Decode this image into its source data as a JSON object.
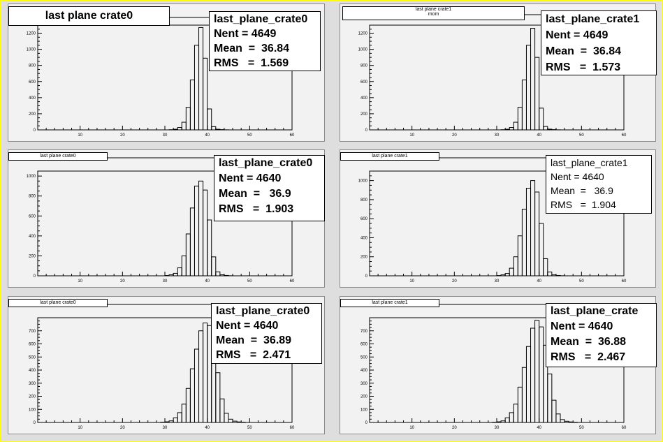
{
  "colors": {
    "frame": "#ffff00",
    "canvas": "#dedede",
    "pad": "#f2f2f2",
    "line": "#000000",
    "box": "#ffffff"
  },
  "chart_data": [
    {
      "type": "bar",
      "title": "last plane crate0",
      "subtitle": "",
      "stats": {
        "name": "last_plane_crate0",
        "entries_label": "Nent = 4649",
        "mean_label": "Mean  =  36.84",
        "rms_label": "RMS   =  1.569"
      },
      "xlim": [
        0,
        60
      ],
      "ylim": [
        0,
        1300
      ],
      "xticks": [
        10,
        20,
        30,
        40,
        50,
        60
      ],
      "xtick_labels": [
        "10",
        "20",
        "30",
        "40",
        "50",
        "60"
      ],
      "yticks": [
        0,
        200,
        400,
        600,
        800,
        1000,
        1200
      ],
      "ytick_labels": [
        "0",
        "200",
        "400",
        "600",
        "800",
        "1000",
        "1200"
      ],
      "bin_width": 1,
      "bins_start": 31,
      "values": [
        2,
        8,
        30,
        95,
        280,
        620,
        1050,
        1270,
        890,
        260,
        40,
        8,
        3,
        1
      ]
    },
    {
      "type": "bar",
      "title": "last plane crate1",
      "subtitle": "mom",
      "stats": {
        "name": "last_plane_crate1",
        "entries_label": "Nent = 4649",
        "mean_label": "Mean  =  36.84",
        "rms_label": "RMS   =  1.573"
      },
      "xlim": [
        0,
        60
      ],
      "ylim": [
        0,
        1300
      ],
      "xticks": [
        10,
        20,
        30,
        40,
        50,
        60
      ],
      "xtick_labels": [
        "10",
        "20",
        "30",
        "40",
        "50",
        "60"
      ],
      "yticks": [
        0,
        200,
        400,
        600,
        800,
        1000,
        1200
      ],
      "ytick_labels": [
        "0",
        "200",
        "400",
        "600",
        "800",
        "1000",
        "1200"
      ],
      "bin_width": 1,
      "bins_start": 31,
      "values": [
        2,
        8,
        30,
        95,
        280,
        620,
        1050,
        1260,
        900,
        270,
        42,
        9,
        3,
        1
      ]
    },
    {
      "type": "bar",
      "title": "last plane crate0",
      "subtitle": "",
      "stats": {
        "name": "last_plane_crate0",
        "entries_label": "Nent = 4640",
        "mean_label": "Mean  =   36.9",
        "rms_label": "RMS   =  1.903"
      },
      "xlim": [
        0,
        60
      ],
      "ylim": [
        0,
        1050
      ],
      "xticks": [
        10,
        20,
        30,
        40,
        50,
        60
      ],
      "xtick_labels": [
        "10",
        "20",
        "30",
        "40",
        "50",
        "60"
      ],
      "yticks": [
        0,
        200,
        400,
        600,
        800,
        1000
      ],
      "ytick_labels": [
        "0",
        "200",
        "400",
        "600",
        "800",
        "1000"
      ],
      "bin_width": 1,
      "bins_start": 30,
      "values": [
        3,
        10,
        25,
        80,
        200,
        420,
        680,
        900,
        950,
        860,
        560,
        190,
        40,
        10,
        4,
        1
      ]
    },
    {
      "type": "bar",
      "title": "last plane crate1",
      "subtitle": "",
      "stats": {
        "name": "last_plane_crate1",
        "entries_label": "Nent = 4640",
        "mean_label": "Mean  =   36.9",
        "rms_label": "RMS   =  1.904"
      },
      "xlim": [
        0,
        60
      ],
      "ylim": [
        0,
        1100
      ],
      "xticks": [
        10,
        20,
        30,
        40,
        50,
        60
      ],
      "xtick_labels": [
        "10",
        "20",
        "30",
        "40",
        "50",
        "60"
      ],
      "yticks": [
        0,
        200,
        400,
        600,
        800,
        1000
      ],
      "ytick_labels": [
        "0",
        "200",
        "400",
        "600",
        "800",
        "1000"
      ],
      "bin_width": 1,
      "bins_start": 30,
      "values": [
        3,
        10,
        25,
        80,
        200,
        420,
        700,
        920,
        1000,
        880,
        550,
        180,
        40,
        10,
        4,
        1
      ]
    },
    {
      "type": "bar",
      "title": "last plane crate0",
      "subtitle": "",
      "stats": {
        "name": "last_plane_crate0",
        "entries_label": "Nent = 4640",
        "mean_label": "Mean  =  36.89",
        "rms_label": "RMS   =  2.471"
      },
      "xlim": [
        0,
        60
      ],
      "ylim": [
        0,
        800
      ],
      "xticks": [
        10,
        20,
        30,
        40,
        50,
        60
      ],
      "xtick_labels": [
        "10",
        "20",
        "30",
        "40",
        "50",
        "60"
      ],
      "yticks": [
        0,
        100,
        200,
        300,
        400,
        500,
        600,
        700
      ],
      "ytick_labels": [
        "0",
        "100",
        "200",
        "300",
        "400",
        "500",
        "600",
        "700"
      ],
      "bin_width": 1,
      "bins_start": 29,
      "values": [
        2,
        5,
        12,
        35,
        75,
        140,
        260,
        410,
        560,
        700,
        760,
        740,
        600,
        380,
        180,
        70,
        25,
        10,
        4,
        2
      ]
    },
    {
      "type": "bar",
      "title": "last plane crate1",
      "subtitle": "",
      "stats": {
        "name": "last_plane_crate",
        "entries_label": "Nent = 4640",
        "mean_label": "Mean  =  36.88",
        "rms_label": "RMS   =  2.467"
      },
      "xlim": [
        0,
        60
      ],
      "ylim": [
        0,
        800
      ],
      "xticks": [
        10,
        20,
        30,
        40,
        50,
        60
      ],
      "xtick_labels": [
        "10",
        "20",
        "30",
        "40",
        "50",
        "60"
      ],
      "yticks": [
        0,
        100,
        200,
        300,
        400,
        500,
        600,
        700
      ],
      "ytick_labels": [
        "0",
        "100",
        "200",
        "300",
        "400",
        "500",
        "600",
        "700"
      ],
      "bin_width": 1,
      "bins_start": 29,
      "values": [
        2,
        5,
        12,
        35,
        75,
        140,
        270,
        420,
        580,
        720,
        780,
        730,
        590,
        370,
        170,
        65,
        22,
        9,
        4,
        2
      ]
    }
  ]
}
